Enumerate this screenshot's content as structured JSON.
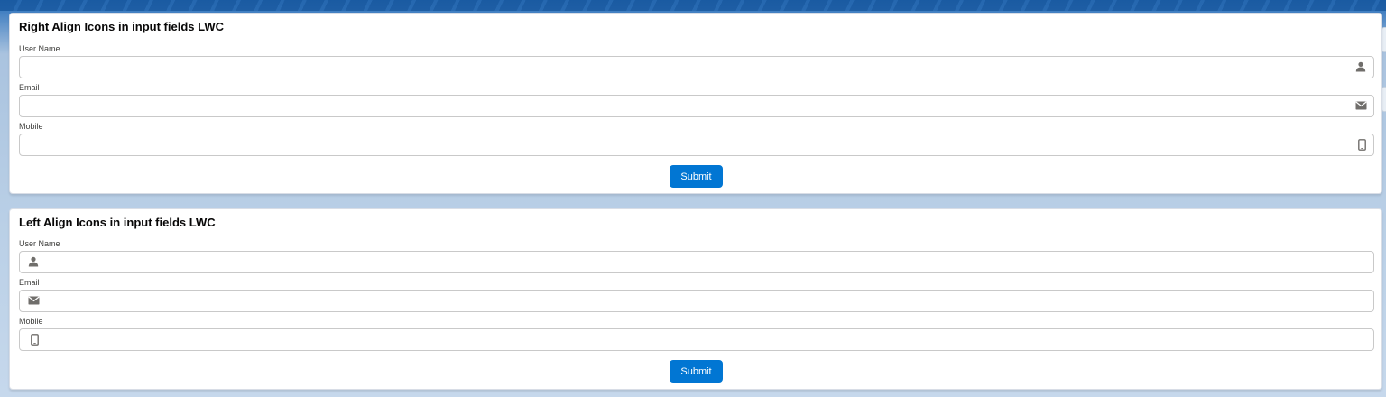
{
  "cards": [
    {
      "title": "Right Align Icons in input fields LWC",
      "icon_position": "right",
      "fields": [
        {
          "label": "User Name",
          "value": "",
          "icon": "user-icon"
        },
        {
          "label": "Email",
          "value": "",
          "icon": "email-icon"
        },
        {
          "label": "Mobile",
          "value": "",
          "icon": "mobile-icon"
        }
      ],
      "submit_label": "Submit"
    },
    {
      "title": "Left Align Icons in input fields LWC",
      "icon_position": "left",
      "fields": [
        {
          "label": "User Name",
          "value": "",
          "icon": "user-icon"
        },
        {
          "label": "Email",
          "value": "",
          "icon": "email-icon"
        },
        {
          "label": "Mobile",
          "value": "",
          "icon": "mobile-icon"
        }
      ],
      "submit_label": "Submit"
    }
  ],
  "colors": {
    "brand": "#0176d3",
    "icon": "#706e6b",
    "border": "#c9c9c9"
  }
}
